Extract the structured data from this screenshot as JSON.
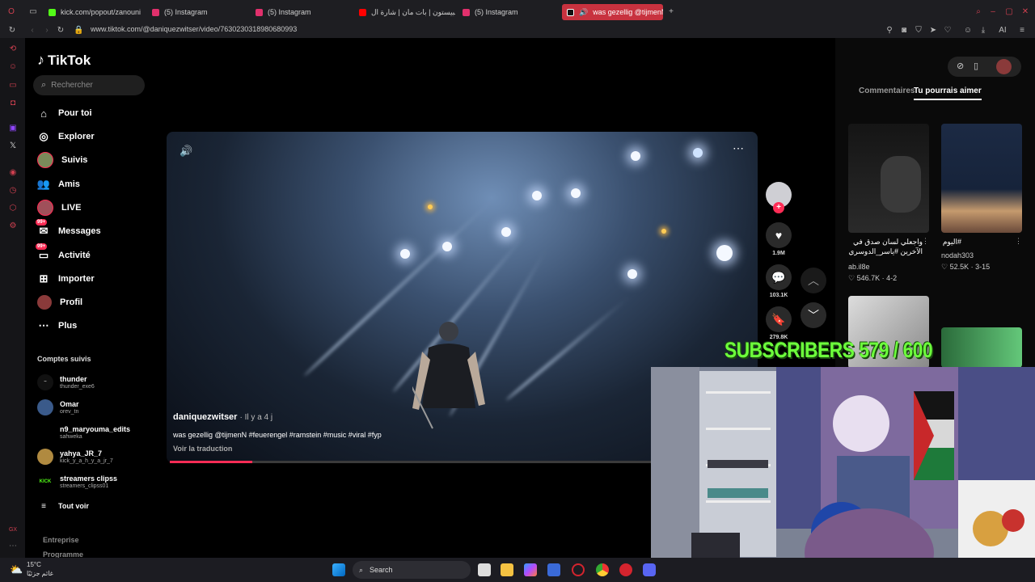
{
  "browser": {
    "tabs": [
      {
        "title": "kick.com/popout/zanouni",
        "color": "#53fc18"
      },
      {
        "title": "(5) Instagram",
        "color": "#e1306c"
      },
      {
        "title": "(5) Instagram",
        "color": "#e1306c"
      },
      {
        "title": "سبيستون | بات مان | شارة ال",
        "color": "#ff0000"
      },
      {
        "title": "(5) Instagram",
        "color": "#e1306c"
      },
      {
        "title": "was gezellig @tijmenN",
        "color": "#fe2c55"
      }
    ],
    "url": "www.tiktok.com/@daniquezwitser/video/7630230318980680993",
    "ai_label": "AI"
  },
  "tiktok": {
    "logo": "TikTok",
    "search_placeholder": "Rechercher",
    "nav": [
      {
        "label": "Pour toi",
        "icon": "home-icon"
      },
      {
        "label": "Explorer",
        "icon": "compass-icon"
      },
      {
        "label": "Suivis",
        "icon": "following-avatar-icon"
      },
      {
        "label": "Amis",
        "icon": "friends-icon"
      },
      {
        "label": "LIVE",
        "icon": "live-icon"
      },
      {
        "label": "Messages",
        "icon": "messages-icon",
        "badge": "99+"
      },
      {
        "label": "Activité",
        "icon": "activity-icon",
        "badge": "99+"
      },
      {
        "label": "Importer",
        "icon": "upload-icon"
      },
      {
        "label": "Profil",
        "icon": "profile-icon"
      },
      {
        "label": "Plus",
        "icon": "more-icon"
      }
    ],
    "followed_title": "Comptes suivis",
    "followed": [
      {
        "name": "thunder",
        "handle": "thunder_exe6"
      },
      {
        "name": "Omar",
        "handle": "orev_tn"
      },
      {
        "name": "n9_maryouma_edits",
        "handle": "sahweka"
      },
      {
        "name": "yahya_JR_7",
        "handle": "kick_y_a_h_y_a_jr_7"
      },
      {
        "name": "streamers clipss",
        "handle": "streamers_clipss01"
      }
    ],
    "see_all": "Tout voir",
    "footer": [
      "Entreprise",
      "Programme"
    ]
  },
  "video": {
    "author": "daniquezwitser",
    "age": "· Il y a 4 j",
    "caption": "was gezellig @tijmenN #feuerengel #ramstein #music #viral #fyp",
    "translate": "Voir la traduction",
    "progress": 0.14
  },
  "actions": {
    "likes": "1.9M",
    "comments": "103.1K",
    "saves": "279.8K"
  },
  "right_panel": {
    "tabs": [
      "Commentaires",
      "Tu pourrais aimer"
    ],
    "suggestions": [
      {
        "title": "واجعلي لسان صدق في الآخرين #ياسر_الدوسري",
        "user": "ab.il8e",
        "stats": "546.7K · 4-2"
      },
      {
        "title": "#اليوم",
        "user": "nodah303",
        "stats": "52.5K · 3-15"
      }
    ]
  },
  "overlay": {
    "subscribers": "SUBSCRIBERS 579 / 600"
  },
  "taskbar": {
    "temperature": "15°C",
    "weather": "غائم جزئيًا",
    "search": "Search"
  }
}
